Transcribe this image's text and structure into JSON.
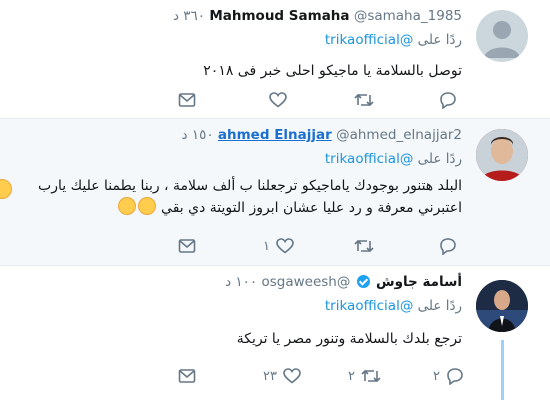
{
  "tweets": [
    {
      "name": "Mahmoud Samaha",
      "handle": "@samaha_1985",
      "time": "٣٦٠ د",
      "reply_prefix": "ردًا على",
      "reply_to": "@trikaofficial",
      "text_lines": [
        "توصل بالسلامة يا ماجيكو احلى خبر فى ٢٠١٨"
      ],
      "replies": "",
      "retweets": "",
      "likes": ""
    },
    {
      "name": "ahmed Elnajjar",
      "handle": "@ahmed_elnajjar2",
      "time": "١٥٠ د",
      "reply_prefix": "ردًا على",
      "reply_to": "@trikaofficial",
      "text_lines": [
        "البلد هتنور بوجودك ياماجيكو ترجعلنا ب ألف سلامة ، ربنا يطمنا عليك يارب",
        "اعتبرني معرفة و رد عليا عشان ابروز التويتة دي بقي"
      ],
      "replies": "",
      "retweets": "",
      "likes": "١"
    },
    {
      "name": "أسامة جاوش",
      "handle": "@osgaweesh",
      "time": "١٠٠ د",
      "reply_prefix": "ردًا على",
      "reply_to": "@trikaofficial",
      "text_lines": [
        "ترجع بلدك بالسلامة وتنور مصر يا تريكة"
      ],
      "replies": "٢",
      "retweets": "٢",
      "likes": "٢٣"
    }
  ],
  "icons": {
    "reply": "reply-icon",
    "retweet": "retweet-icon",
    "like": "heart-icon",
    "dm": "envelope-icon",
    "verified": "verified-badge-icon"
  },
  "colors": {
    "link": "#1b95e0",
    "muted": "#657786",
    "highlight_bg": "#f5f8fa",
    "thread_line": "#9cd0f6"
  }
}
